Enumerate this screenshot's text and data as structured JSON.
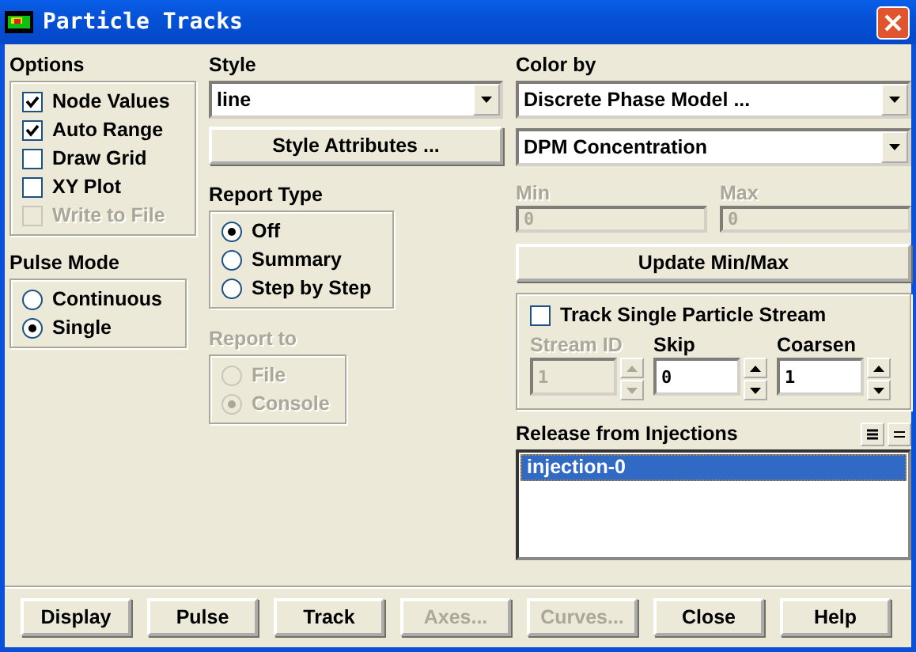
{
  "window": {
    "title": "Particle Tracks"
  },
  "options": {
    "label": "Options",
    "items": [
      {
        "label": "Node Values",
        "checked": true,
        "disabled": false
      },
      {
        "label": "Auto Range",
        "checked": true,
        "disabled": false
      },
      {
        "label": "Draw Grid",
        "checked": false,
        "disabled": false
      },
      {
        "label": "XY Plot",
        "checked": false,
        "disabled": false
      },
      {
        "label": "Write to File",
        "checked": false,
        "disabled": true
      }
    ]
  },
  "pulse_mode": {
    "label": "Pulse Mode",
    "items": [
      {
        "label": "Continuous",
        "selected": false
      },
      {
        "label": "Single",
        "selected": true
      }
    ]
  },
  "style": {
    "label": "Style",
    "value": "line",
    "button": "Style Attributes ..."
  },
  "report_type": {
    "label": "Report Type",
    "items": [
      {
        "label": "Off",
        "selected": true
      },
      {
        "label": "Summary",
        "selected": false
      },
      {
        "label": "Step by Step",
        "selected": false
      }
    ]
  },
  "report_to": {
    "label": "Report to",
    "disabled": true,
    "items": [
      {
        "label": "File",
        "selected": false
      },
      {
        "label": "Console",
        "selected": true
      }
    ]
  },
  "color_by": {
    "label": "Color by",
    "category": "Discrete Phase Model ...",
    "quantity": "DPM Concentration"
  },
  "range": [
    {
      "label": "Min",
      "value": "0",
      "disabled": true
    },
    {
      "label": "Max",
      "value": "0",
      "disabled": true
    }
  ],
  "update_button": "Update Min/Max",
  "single_stream": {
    "label": "Track Single Particle Stream",
    "checked": false,
    "fields": [
      {
        "label": "Stream ID",
        "value": "1",
        "disabled": true
      },
      {
        "label": "Skip",
        "value": "0",
        "disabled": false
      },
      {
        "label": "Coarsen",
        "value": "1",
        "disabled": false
      }
    ]
  },
  "injections": {
    "label": "Release from Injections",
    "items": [
      {
        "label": "injection-0",
        "selected": true
      }
    ]
  },
  "buttons": [
    {
      "label": "Display",
      "disabled": false
    },
    {
      "label": "Pulse",
      "disabled": false
    },
    {
      "label": "Track",
      "disabled": false
    },
    {
      "label": "Axes...",
      "disabled": true
    },
    {
      "label": "Curves...",
      "disabled": true
    },
    {
      "label": "Close",
      "disabled": false
    },
    {
      "label": "Help",
      "disabled": false
    }
  ]
}
